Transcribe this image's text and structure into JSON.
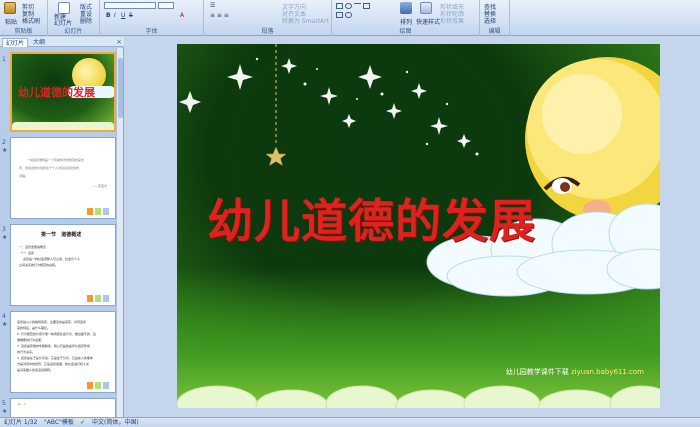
{
  "ribbon": {
    "groups": {
      "clipboard": "剪贴板",
      "slides": "幻灯片",
      "font": "字体",
      "paragraph": "段落",
      "drawing": "绘图",
      "editing": "编辑"
    },
    "paste": "粘贴",
    "cut": "剪切",
    "copy": "复制",
    "format_painter": "格式刷",
    "new_slide": "新建\n幻灯片",
    "layout": "版式",
    "reset": "重设",
    "delete": "删除",
    "text_direction": "文字方向",
    "align_text": "对齐文本",
    "convert_smartart": "转换为 SmartArt",
    "arrange": "排列",
    "quick_styles": "快速样式",
    "shape_fill": "形状填充",
    "shape_outline": "形状轮廓",
    "shape_effects": "形状效果",
    "find": "查找",
    "replace": "替换",
    "select": "选择"
  },
  "pane": {
    "tabs": [
      "幻灯片",
      "大纲"
    ],
    "close": "×",
    "slides": [
      {
        "num": "1",
        "title": "幼儿道德的发展",
        "selected": true
      },
      {
        "num": "2",
        "lines": [
          "一种道德准则是一个有独特市场规范的来世",
          "界，但道德的价值却在于个人对自身道德性修",
          "养程。",
          "——皮亚杰"
        ]
      },
      {
        "num": "3",
        "heading": "第一节   道德概述",
        "lines": [
          "一、道德含義與概念",
          "（一）道德",
          "道德是一种社会调整人们之间、社会与个人",
          "之间关系的行为规范的总和。"
        ]
      },
      {
        "num": "4",
        "lines": [
          "道德是以人的独特来原，主要靠的是来原、对待道德",
          "来的特征，是什么理论。",
          "2. 行为规范的价值与准一种调控社会行为，做出做不的，后",
          "果推断的行为后果。",
          "3. 道德是有维的非强制性，我心们是的是评价道德形成",
          "的行为关系。",
          "4. 道德是在于是分享运，它是在于分享，它是在人的事体",
          "方是对待中的世界，它是道德发展，新社会进行机人文",
          "是对来做人的来道德规则。"
        ]
      },
      {
        "num": "5"
      }
    ]
  },
  "slide": {
    "title": "幼儿道德的发展",
    "footer_prefix": "幼儿园教学课件下载",
    "footer_site": "ziyuan.baby611.com"
  },
  "status": {
    "slide_count": "幻灯片 1/32",
    "theme": "\"ABC\"模板",
    "language": "中文(简体，中国)"
  }
}
